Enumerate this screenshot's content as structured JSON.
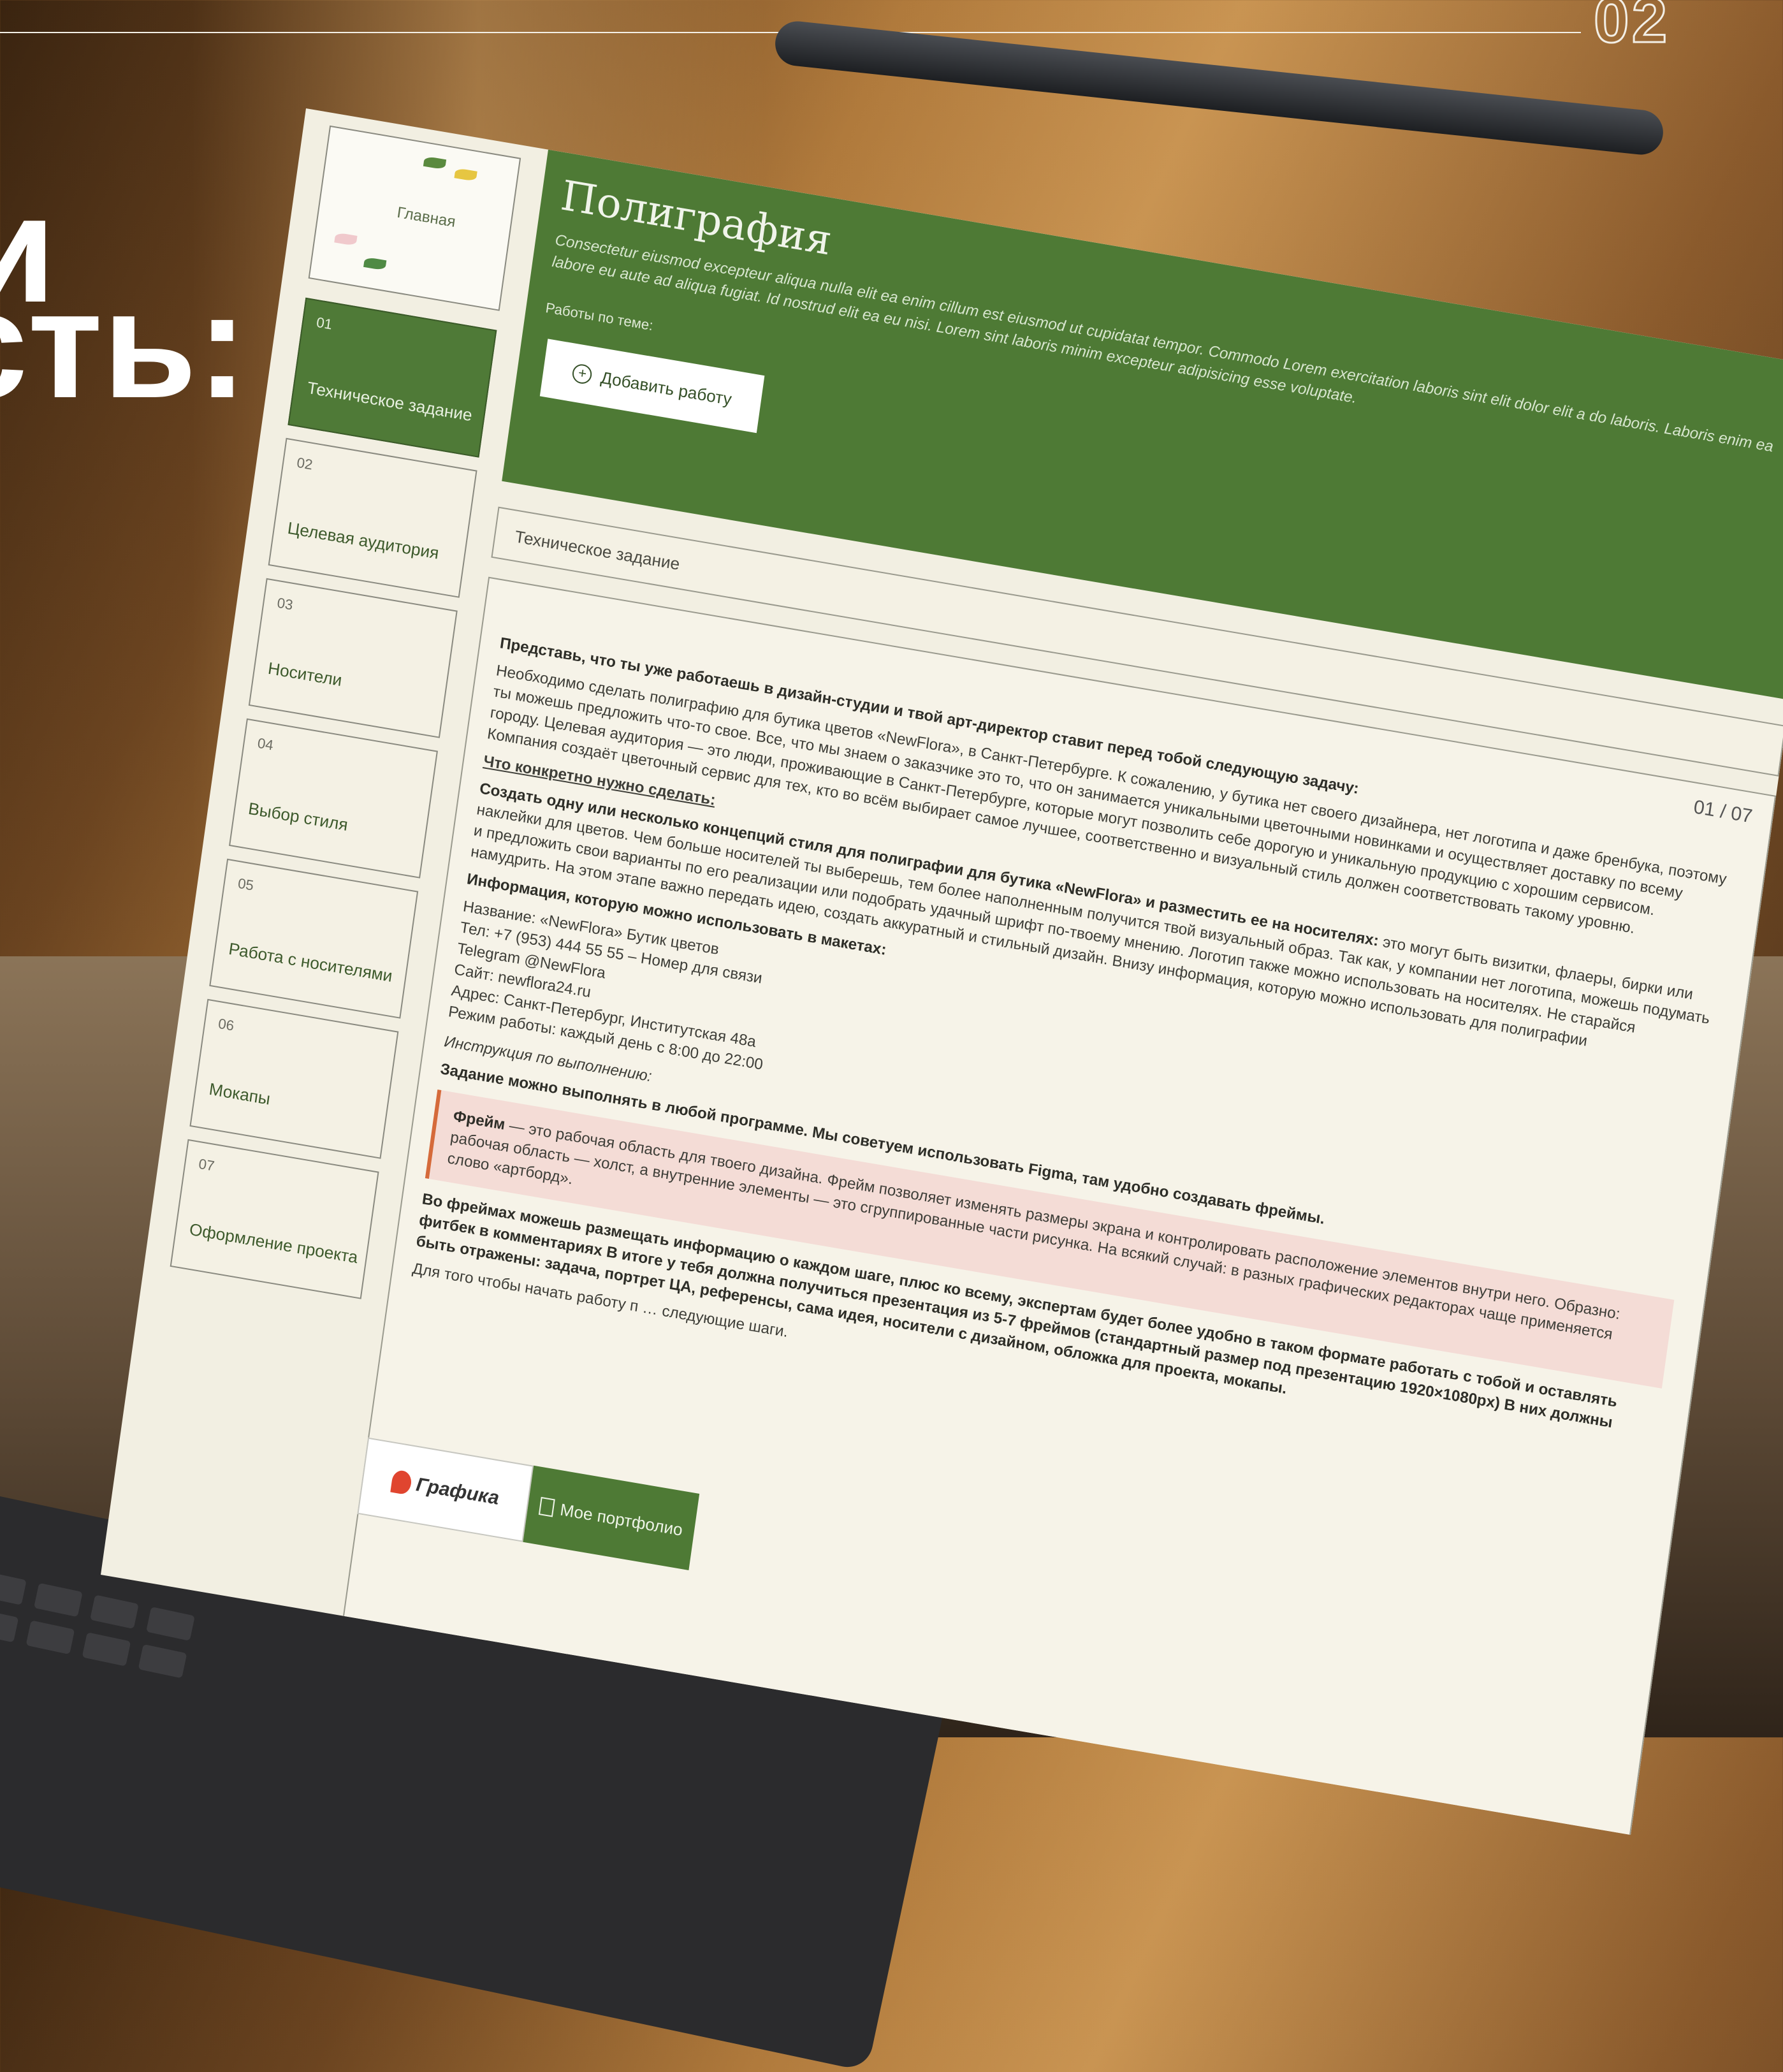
{
  "page": {
    "page_number": "02",
    "headline_fragment_1": "и",
    "headline_fragment_2": "сть:"
  },
  "sidebar": {
    "home_label": "Главная",
    "items": [
      {
        "num": "01",
        "label": "Техническое задание",
        "active": true
      },
      {
        "num": "02",
        "label": "Целевая аудитория"
      },
      {
        "num": "03",
        "label": "Носители"
      },
      {
        "num": "04",
        "label": "Выбор стиля"
      },
      {
        "num": "05",
        "label": "Работа с носителями"
      },
      {
        "num": "06",
        "label": "Мокапы"
      },
      {
        "num": "07",
        "label": "Оформление проекта"
      }
    ]
  },
  "hero": {
    "title": "Полиграфия",
    "description": "Consectetur eiusmod excepteur aliqua nulla elit ea enim cillum est eiusmod ut cupidatat tempor. Commodo Lorem exercitation laboris sint elit dolor elit a do laboris. Laboris enim ea labore eu aute ad aliqua fugiat. Id nostrud elit ea eu nisi. Lorem sint laboris minim excepteur adipisicing esse voluptate.",
    "subtitle": "Работы по теме:",
    "add_button_label": "Добавить работу"
  },
  "section": {
    "title": "Техническое задание",
    "counter": "01 / 07"
  },
  "content": {
    "intro_heading": "Представь, что ты уже работаешь в дизайн-студии и твой арт-директор ставит перед тобой следующую задачу:",
    "intro_text": "Необходимо сделать полиграфию для бутика цветов «NewFlora», в Санкт-Петербурге. К сожалению, у бутика нет своего дизайнера, нет логотипа и даже бренбука, поэтому ты можешь предложить что-то свое. Все, что мы знаем о заказчике это то, что он занимается уникальными цветочными новинками и осуществляет доставку по всему городу. Целевая аудитория — это люди, проживающие в Санкт-Петербурге, которые могут позволить себе дорогую и уникальную продукцию с хорошим сервисом. Компания создаёт цветочный сервис для тех, кто во всём выбирает самое лучшее, соответственно и визуальный стиль должен соответствовать такому уровню.",
    "todo_heading": "Что конкретно нужно сделать:",
    "todo_bold": "Создать одну или несколько концепций стиля для полиграфии для бутика «NewFlora» и разместить ее на носителях:",
    "todo_text": " это могут быть визитки, флаеры, бирки или наклейки для цветов. Чем больше носителей ты выберешь, тем более наполненным получится твой визуальный образ. Так как, у компании нет логотипа, можешь подумать и предложить свои варианты по его реализации или подобрать удачный шрифт по-твоему мнению. Логотип также можно использовать на носителях. Не старайся намудрить. На этом этапе важно передать идею, создать аккуратный и стильный дизайн. Внизу информация, которую можно использовать для полиграфии",
    "info_heading": "Информация, которую можно использовать в макетах:",
    "info_lines": [
      "Название: «NewFlora» Бутик цветов",
      "Тел: +7 (953) 444 55 55 – Номер для связи",
      "Telegram @NewFlora",
      "Сайт: newflora24.ru",
      "Адрес: Санкт-Петербург, Институтская 48а",
      "Режим работы: каждый день с 8:00 до 22:00"
    ],
    "instruction_label": "Инструкция по выполнению:",
    "instruction_bold": "Задание можно выполнять в любой программе. Мы советуем использовать Figma, там удобно создавать фреймы.",
    "note_bold": "Фрейм",
    "note_text": " — это рабочая область для твоего дизайна. Фрейм позволяет изменять размеры экрана и контролировать расположение элементов внутри него. Образно: рабочая область — холст, а внутренние элементы — это сгруппированные части рисунка. На всякий случай: в разных графических редакторах чаще применяется слово «артборд».",
    "frames_text": "Во фреймах можешь размещать информацию о каждом шаге, плюс ко всему, экспертам будет более удобно в таком формате работать с тобой и оставлять фитбек в комментариях В итоге у тебя должна получиться презентация из 5-7 фреймов (стандартный размер под презентацию 1920×1080px) В них должны быть отражены: задача, портрет ЦА, референсы, сама идея, носители с дизайном, обложка для проекта, мокапы.",
    "start_text": "Для того чтобы начать работу п",
    "start_text_tail": "следующие шаги."
  },
  "footer": {
    "logo_text": "Графика",
    "portfolio_label": "Мое портфолио"
  },
  "colors": {
    "accent_green": "#4e7a35",
    "note_background": "#f4dcd6",
    "note_border": "#d56a3a",
    "screen_background": "#f2efe2"
  }
}
